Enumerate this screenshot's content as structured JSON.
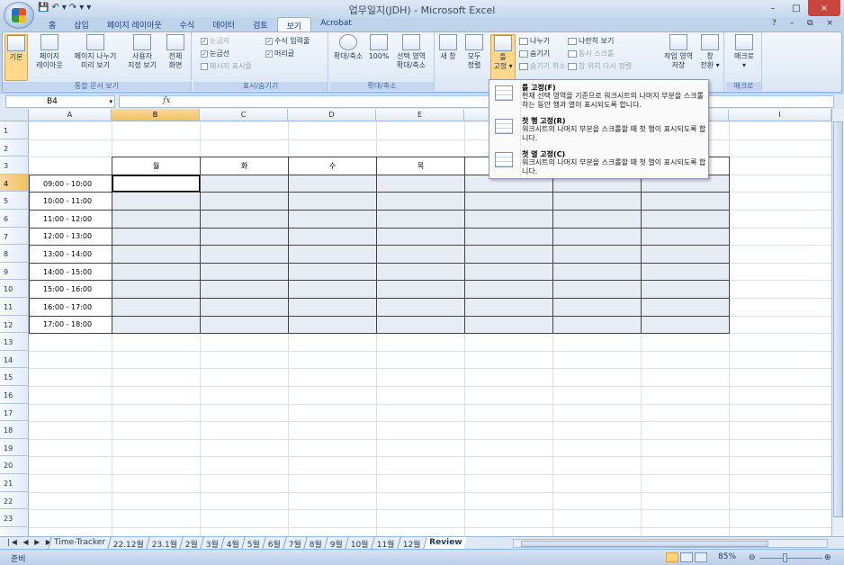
{
  "window": {
    "title": "업무일지(JDH) - Microsoft Excel",
    "min": "–",
    "max": "□",
    "close": "×"
  },
  "qat": {
    "save": "💾",
    "undo": "↶",
    "undo_dd": "▾",
    "redo": "↷",
    "redo_dd": "▾",
    "custom": "▾"
  },
  "tabs": [
    "홈",
    "삽입",
    "페이지 레이아웃",
    "수식",
    "데이터",
    "검토",
    "보기",
    "Acrobat"
  ],
  "active_tab": "보기",
  "ribbon_right_ctrls": "? – ⧉ ×",
  "ribbon": {
    "workbook_views": {
      "label": "통합 문서 보기",
      "buttons": [
        {
          "l1": "기본",
          "l2": ""
        },
        {
          "l1": "페이지",
          "l2": "레이아웃"
        },
        {
          "l1": "페이지 나누기",
          "l2": "미리 보기"
        },
        {
          "l1": "사용자",
          "l2": "지정 보기"
        },
        {
          "l1": "전체",
          "l2": "화면"
        }
      ]
    },
    "show_hide": {
      "label": "표시/숨기기",
      "ruler": "눈금자",
      "gridlines": "눈금선",
      "message_bar": "메시지 표시줄",
      "formula_bar": "수식 입력줄",
      "headings": "머리글"
    },
    "zoom": {
      "label": "확대/축소",
      "buttons": [
        {
          "l1": "확대/축소",
          "l2": ""
        },
        {
          "l1": "100%",
          "l2": ""
        },
        {
          "l1": "선택 영역",
          "l2": "확대/축소"
        }
      ]
    },
    "window": {
      "new_window": "새 창",
      "arrange_l1": "모두",
      "arrange_l2": "정렬",
      "freeze_l1": "틀",
      "freeze_l2": "고정 ▾",
      "split": "나누기",
      "hide": "숨기기",
      "unhide": "숨기기 취소",
      "side_by_side": "나란히 보기",
      "sync_scroll": "동시 스크롤",
      "reset_pos": "창 위치 다시 정렬",
      "save_ws_l1": "작업 영역",
      "save_ws_l2": "저장",
      "switch_l1": "창",
      "switch_l2": "전환 ▾"
    },
    "macro": {
      "label": "매크로",
      "l1": "매크로",
      "l2": "▾"
    }
  },
  "formula_bar": {
    "name_box": "B4",
    "dd": "▾",
    "fx": "fx",
    "value": ""
  },
  "columns": [
    "A",
    "B",
    "C",
    "D",
    "E",
    "",
    "",
    "",
    "I"
  ],
  "rows": [
    "1",
    "2",
    "3",
    "4",
    "5",
    "6",
    "7",
    "8",
    "9",
    "10",
    "11",
    "12",
    "13",
    "14",
    "15",
    "16",
    "17",
    "18",
    "19",
    "20",
    "21",
    "22",
    "23",
    ""
  ],
  "table": {
    "days": [
      "월",
      "화",
      "수",
      "목",
      "",
      "",
      ""
    ],
    "times": [
      "09:00 - 10:00",
      "10:00 - 11:00",
      "11:00 - 12:00",
      "12:00 - 13:00",
      "13:00 - 14:00",
      "14:00 - 15:00",
      "15:00 - 16:00",
      "16:00 - 17:00",
      "17:00 - 18:00"
    ]
  },
  "freeze_menu": [
    {
      "title": "틀 고정(F)",
      "desc": "현재 선택 영역을 기준으로 워크시트의 나머지 부분을 스크롤하는 동안 행과 열이 표시되도록 합니다."
    },
    {
      "title": "첫 행 고정(R)",
      "desc": "워크시트의 나머지 부분을 스크롤할 때 첫 행이 표시되도록 합니다."
    },
    {
      "title": "첫 열 고정(C)",
      "desc": "워크시트의 나머지 부분을 스크롤할 때 첫 열이 표시되도록 합니다."
    }
  ],
  "sheet_nav": "|◀ ◀ ▶ ▶|",
  "sheets": [
    "Time-Tracker",
    "22.12월",
    "23.1월",
    "2월",
    "3월",
    "4월",
    "5월",
    "6월",
    "7월",
    "8월",
    "9월",
    "10월",
    "11월",
    "12월",
    "Review"
  ],
  "active_sheet": "Review",
  "status": {
    "ready": "준비",
    "zoom": "85%",
    "zoom_minus": "⊖",
    "zoom_plus": "⊕"
  }
}
